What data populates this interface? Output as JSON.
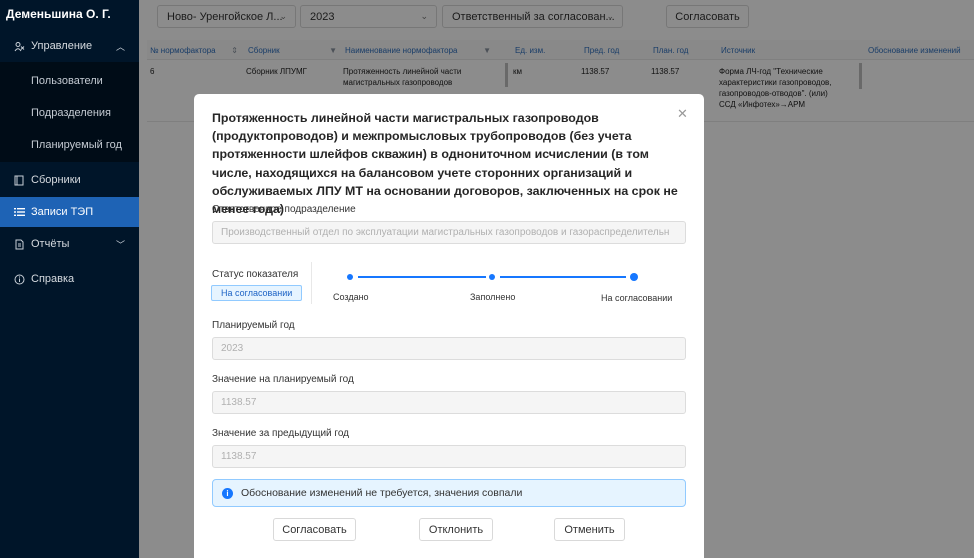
{
  "user": {
    "name": "Деменьшина О. Г."
  },
  "sidebar": {
    "items": [
      {
        "label": "Управление",
        "icon": "users-icon"
      },
      {
        "label": "Пользователи"
      },
      {
        "label": "Подразделения"
      },
      {
        "label": "Планируемый год"
      },
      {
        "label": "Сборники",
        "icon": "book-icon"
      },
      {
        "label": "Записи ТЭП",
        "icon": "list-icon"
      },
      {
        "label": "Отчёты",
        "icon": "file-icon"
      },
      {
        "label": "Справка",
        "icon": "info-icon"
      }
    ]
  },
  "toolbar": {
    "branch": "Ново- Уренгойское Л...",
    "year": "2023",
    "responsible": "Ответственный за согласован...",
    "approve_label": "Согласовать"
  },
  "table": {
    "headers": [
      "№ нормофактора",
      "Сборник",
      "Наименование нормофактора",
      "Ед. изм.",
      "Пред. год",
      "План. год",
      "Источник",
      "Обоснование изменений"
    ],
    "row": {
      "num": "6",
      "collection": "Сборник ЛПУМГ",
      "name_line1": "Протяженность линейной части",
      "name_line2": "магистральных газопроводов",
      "unit": "км",
      "prev_year": "1138.57",
      "plan_year": "1138.57",
      "source_line1": "Форма ЛЧ-год \"Технические",
      "source_line2": "характеристики газопроводов,",
      "source_line3": "газопроводов-отводов\". (или)",
      "source_line4": "ССД «Инфотех»→АРМ"
    }
  },
  "modal": {
    "title": "Протяженность линейной части магистральных газопроводов (продуктопроводов) и межпромысловых трубопроводов (без учета протяженности шлейфов скважин) в однониточном исчислении (в том числе, находящихся на балансовом учете сторонних организаций и обслуживаемых ЛПУ МТ на основании договоров, заключенных на срок не менее года)",
    "department_label": "Ответственное подразделение",
    "department_value": "Производственный отдел по эксплуатации магистральных газопроводов и газораспределительн",
    "status_label": "Статус показателя",
    "status_tag": "На согласовании",
    "steps": [
      "Создано",
      "Заполнено",
      "На согласовании"
    ],
    "plan_year_label": "Планируемый год",
    "plan_year_value": "2023",
    "plan_value_label": "Значение на планируемый год",
    "plan_value": "1138.57",
    "prev_value_label": "Значение за предыдущий год",
    "prev_value": "1138.57",
    "info_text": "Обоснование изменений не требуется, значения совпали",
    "buttons": {
      "approve": "Согласовать",
      "reject": "Отклонить",
      "cancel": "Отменить"
    }
  },
  "colors": {
    "sidebar": "#001529",
    "accent": "#1677ff",
    "active": "#1e63b5"
  }
}
